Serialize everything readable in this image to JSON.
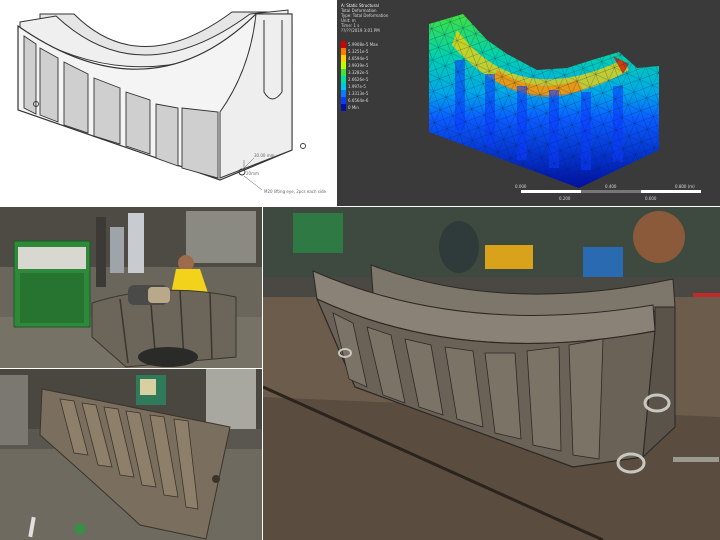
{
  "cad": {
    "note_top": "30.00 mm",
    "note_mid": "20mm",
    "note_bottom": "M20 lifting eye, 2pcs each side"
  },
  "fea": {
    "header_lines": [
      "A: Static Structural",
      "Total Deformation",
      "Type: Total Deformation",
      "Unit: m",
      "Time: 1 s",
      "??/??/2019 3:01 PM"
    ],
    "legend": [
      {
        "label": "5.9908e-5 Max",
        "color": "#d40000"
      },
      {
        "label": "5.3251e-5",
        "color": "#ff7a00"
      },
      {
        "label": "4.6594e-5",
        "color": "#ffd100"
      },
      {
        "label": "3.9939e-5",
        "color": "#b8ff00"
      },
      {
        "label": "3.3282e-5",
        "color": "#3fe23f"
      },
      {
        "label": "2.6626e-5",
        "color": "#00e0a0"
      },
      {
        "label": "1.997e-5",
        "color": "#00c8e8"
      },
      {
        "label": "1.3313e-5",
        "color": "#0a7cff"
      },
      {
        "label": "6.6564e-6",
        "color": "#0a3cff"
      },
      {
        "label": "0 Min",
        "color": "#0010a0"
      }
    ],
    "scale_ticks": [
      "0.000",
      "0.400",
      "0.800 (m)"
    ],
    "scale_sub_ticks": [
      "0.200",
      "0.600"
    ]
  },
  "colors": {
    "cad_line": "#333333",
    "cad_face": "#f4f4f4",
    "cad_shade": "#cfcfcf",
    "fea_bg": "#3a3a3a",
    "steel": "#6e6558"
  }
}
